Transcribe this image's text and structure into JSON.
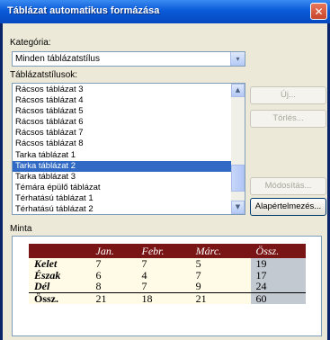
{
  "window": {
    "title": "Táblázat automatikus formázása",
    "close_label": "✕"
  },
  "category": {
    "label": "Kategória:",
    "value": "Minden táblázatstílus",
    "arrow": "▾"
  },
  "styles": {
    "label": "Táblázatstílusok:",
    "items": [
      "Rácsos táblázat 3",
      "Rácsos táblázat 4",
      "Rácsos táblázat 5",
      "Rácsos táblázat 6",
      "Rácsos táblázat 7",
      "Rácsos táblázat 8",
      "Tarka táblázat 1",
      "Tarka táblázat 2",
      "Tarka táblázat 3",
      "Témára épülő táblázat",
      "Térhatású táblázat 1",
      "Térhatású táblázat 2"
    ],
    "selected_index": 7,
    "scroll_up": "▲",
    "scroll_down": "▼"
  },
  "buttons": {
    "new": "Új...",
    "delete": "Törlés...",
    "modify": "Módosítás...",
    "default": "Alapértelmezés..."
  },
  "sample": {
    "label": "Minta",
    "headers": [
      "",
      "Jan.",
      "Febr.",
      "Márc.",
      "Össz."
    ],
    "rows": [
      [
        "Kelet",
        "7",
        "7",
        "5",
        "19"
      ],
      [
        "Észak",
        "6",
        "4",
        "7",
        "17"
      ],
      [
        "Dél",
        "8",
        "7",
        "9",
        "24"
      ],
      [
        "Össz.",
        "21",
        "18",
        "21",
        "60"
      ]
    ]
  }
}
